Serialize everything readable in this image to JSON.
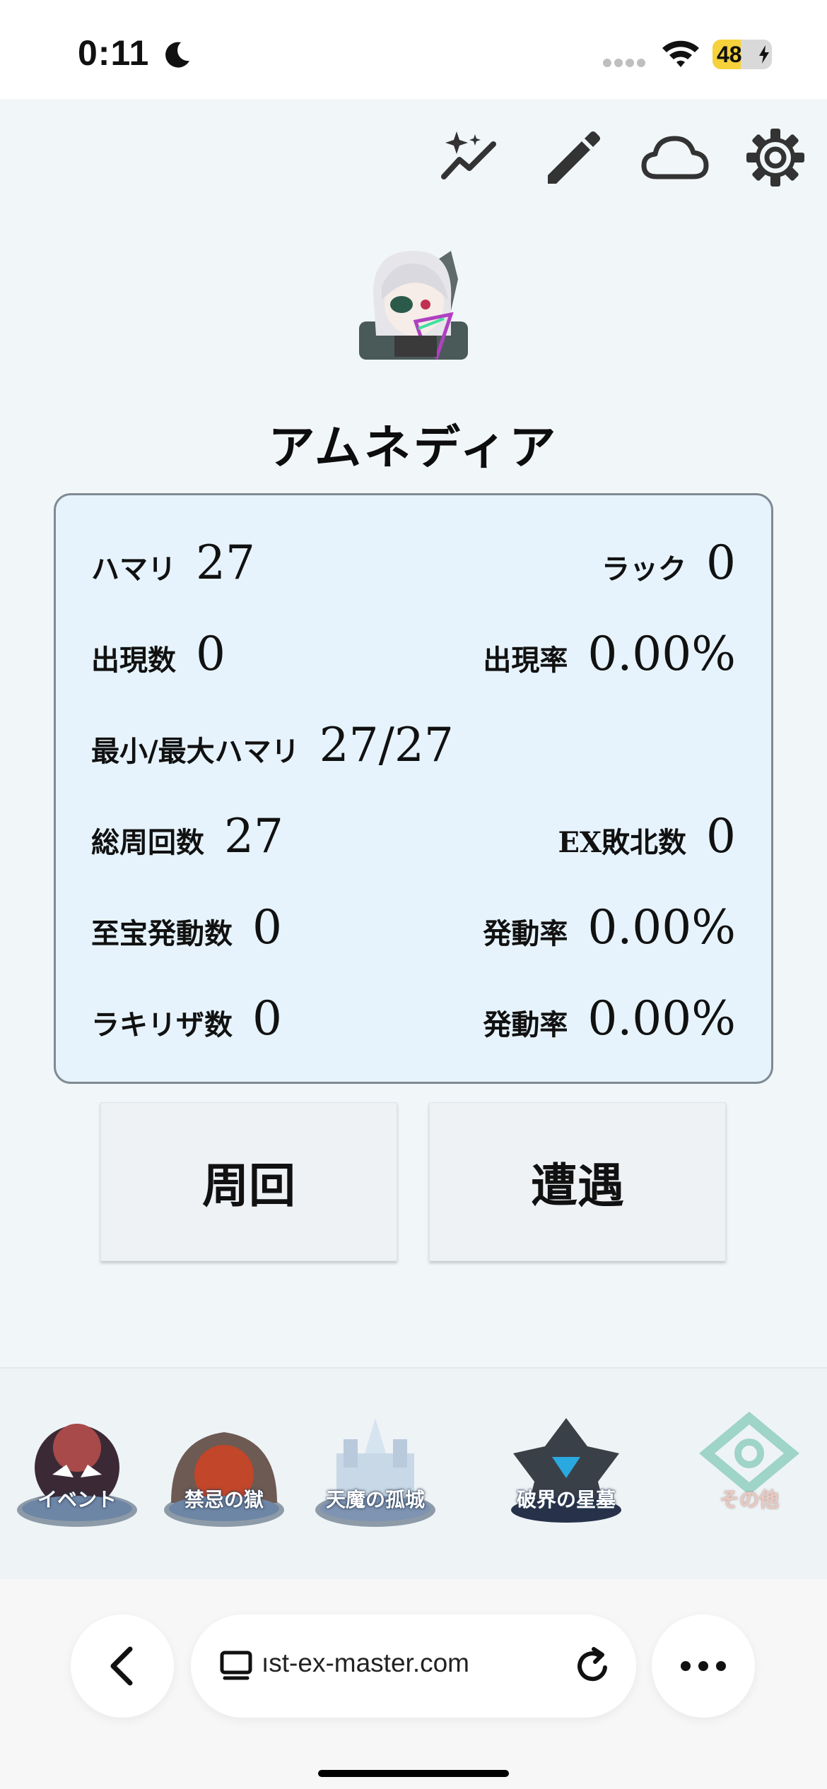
{
  "status_bar": {
    "time": "0:11",
    "battery": "48",
    "battery_level": 0.48
  },
  "toolbar": {
    "icons": [
      "sparkle-trend-icon",
      "pencil-icon",
      "cloud-icon",
      "gear-icon"
    ]
  },
  "monster": {
    "name": "アムネディア"
  },
  "stats": {
    "row1": {
      "left_label": "ハマリ",
      "left_value": "27",
      "right_label": "ラック",
      "right_value": "0"
    },
    "row2": {
      "left_label": "出現数",
      "left_value": "0",
      "right_label": "出現率",
      "right_value": "0.00%"
    },
    "row3": {
      "left_label": "最小/最大ハマリ",
      "left_value": "27/27"
    },
    "row4": {
      "left_label": "総周回数",
      "left_value": "27",
      "right_label": "EX敗北数",
      "right_value": "0"
    },
    "row5": {
      "left_label": "至宝発動数",
      "left_value": "0",
      "right_label": "発動率",
      "right_value": "0.00%"
    },
    "row6": {
      "left_label": "ラキリザ数",
      "left_value": "0",
      "right_label": "発動率",
      "right_value": "0.00%"
    }
  },
  "actions": {
    "lap_label": "周回",
    "encounter_label": "遭遇"
  },
  "bottom_nav": {
    "items": [
      {
        "label": "イベント"
      },
      {
        "label": "禁忌の獄"
      },
      {
        "label": "天魔の孤城"
      },
      {
        "label": "破界の星墓"
      },
      {
        "label": "その他"
      }
    ]
  },
  "browser": {
    "url": "ıst-ex-master.com"
  }
}
